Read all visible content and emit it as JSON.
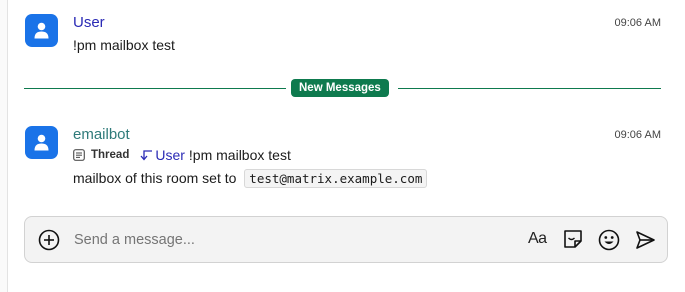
{
  "messages": [
    {
      "sender": "User",
      "sender_color": "#2a2ab5",
      "time": "09:06 AM",
      "body": "!pm mailbox test"
    },
    {
      "sender": "emailbot",
      "sender_color": "#2f7b7a",
      "time": "09:06 AM",
      "thread_label": "Thread",
      "reply_to_user": "User",
      "reply_to_text": "!pm mailbox test",
      "body_prefix": "mailbox of this room set to",
      "body_code": "test@matrix.example.com"
    }
  ],
  "divider": {
    "label": "New Messages",
    "color": "#0e7a4e"
  },
  "composer": {
    "placeholder": "Send a message...",
    "format_label": "Aa",
    "icons": [
      "add-circle-icon",
      "text-format-icon",
      "sticker-icon",
      "emoji-icon",
      "send-icon"
    ]
  }
}
